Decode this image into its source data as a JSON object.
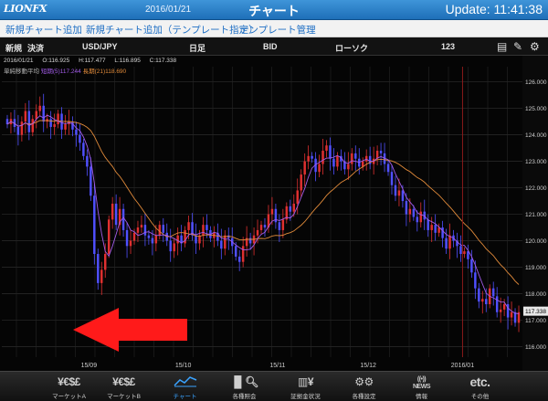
{
  "header": {
    "logo": "LIONFX",
    "date": "2016/01/21",
    "title": "チャート",
    "update": "Update: 11:41:38"
  },
  "links": [
    "新規チャート追加",
    "新規チャート追加（テンプレート指定）",
    "テンプレート管理"
  ],
  "toolbar": {
    "order": "新規",
    "settle": "決済",
    "pair": "USD/JPY",
    "period": "日足",
    "side": "BID",
    "chart_type": "ローソク",
    "count": "123"
  },
  "ohlc": {
    "date": "2016/01/21",
    "open": "O:116.925",
    "high": "H:117.477",
    "low": "L:116.895",
    "close": "C:117.338"
  },
  "ma": {
    "label": "単純移動平均",
    "short": "短期(5)117.244",
    "long": "長期(21)118.690"
  },
  "current_price": "117.338",
  "tabs": [
    {
      "icon": "¥€$£",
      "label": "マーケットA"
    },
    {
      "icon": "¥€$£",
      "label": "マーケットB"
    },
    {
      "icon": "chart-icon",
      "label": "チャート"
    },
    {
      "icon": "search-chart-icon",
      "label": "各種照会"
    },
    {
      "icon": "deposit-icon",
      "label": "証拠金状況"
    },
    {
      "icon": "gear-icon",
      "label": "各種設定"
    },
    {
      "icon": "news-icon",
      "label": "情報"
    },
    {
      "icon": "etc.",
      "label": "その他"
    }
  ],
  "chart_data": {
    "type": "candlestick",
    "pair": "USD/JPY",
    "timeframe": "daily",
    "x_tick_labels": [
      "15/09",
      "15/10",
      "15/11",
      "15/12",
      "2016/01"
    ],
    "y_tick_labels": [
      "116.000",
      "117.000",
      "118.000",
      "119.000",
      "120.000",
      "121.000",
      "122.000",
      "123.000",
      "124.000",
      "125.000",
      "126.000"
    ],
    "ylim": [
      115.6,
      126.3
    ],
    "bull_color": "#e03030",
    "bear_color": "#5050ff",
    "short_ma_color": "#a25ce8",
    "long_ma_color": "#e08a3a",
    "close": [
      124.4,
      124.6,
      124.3,
      124.0,
      124.5,
      124.9,
      124.1,
      124.6,
      124.9,
      125.1,
      124.5,
      124.6,
      124.3,
      124.4,
      124.8,
      124.2,
      124.4,
      124.5,
      124.2,
      124.0,
      123.7,
      123.2,
      122.8,
      121.7,
      119.5,
      118.4,
      118.9,
      119.5,
      120.8,
      121.4,
      120.6,
      121.2,
      120.4,
      119.8,
      120.0,
      120.3,
      120.5,
      120.6,
      120.2,
      120.1,
      119.9,
      120.2,
      120.6,
      120.3,
      120.0,
      119.6,
      119.9,
      120.2,
      119.9,
      120.4,
      120.7,
      120.2,
      119.9,
      120.2,
      120.6,
      120.4,
      120.1,
      120.3,
      120.0,
      119.7,
      120.2,
      120.1,
      119.8,
      119.4,
      119.2,
      119.8,
      120.1,
      119.9,
      120.2,
      120.4,
      120.6,
      120.5,
      121.0,
      121.2,
      120.7,
      120.4,
      120.8,
      121.3,
      121.1,
      121.4,
      121.9,
      122.5,
      123.0,
      123.2,
      123.1,
      122.6,
      122.9,
      123.4,
      123.6,
      123.1,
      122.8,
      123.2,
      123.0,
      122.7,
      122.9,
      123.3,
      123.1,
      122.8,
      123.0,
      123.2,
      122.9,
      123.1,
      123.4,
      123.3,
      122.9,
      122.6,
      122.1,
      121.7,
      121.9,
      121.5,
      121.0,
      121.2,
      120.9,
      120.7,
      121.1,
      120.8,
      120.4,
      120.6,
      120.3,
      120.5,
      120.1,
      119.7,
      120.2,
      120.0,
      119.8,
      119.5,
      119.6,
      119.3,
      118.8,
      118.2,
      117.7,
      117.8,
      117.6,
      118.2,
      117.9,
      117.3,
      117.4,
      117.6,
      117.1,
      117.3,
      116.9,
      117.3
    ]
  }
}
